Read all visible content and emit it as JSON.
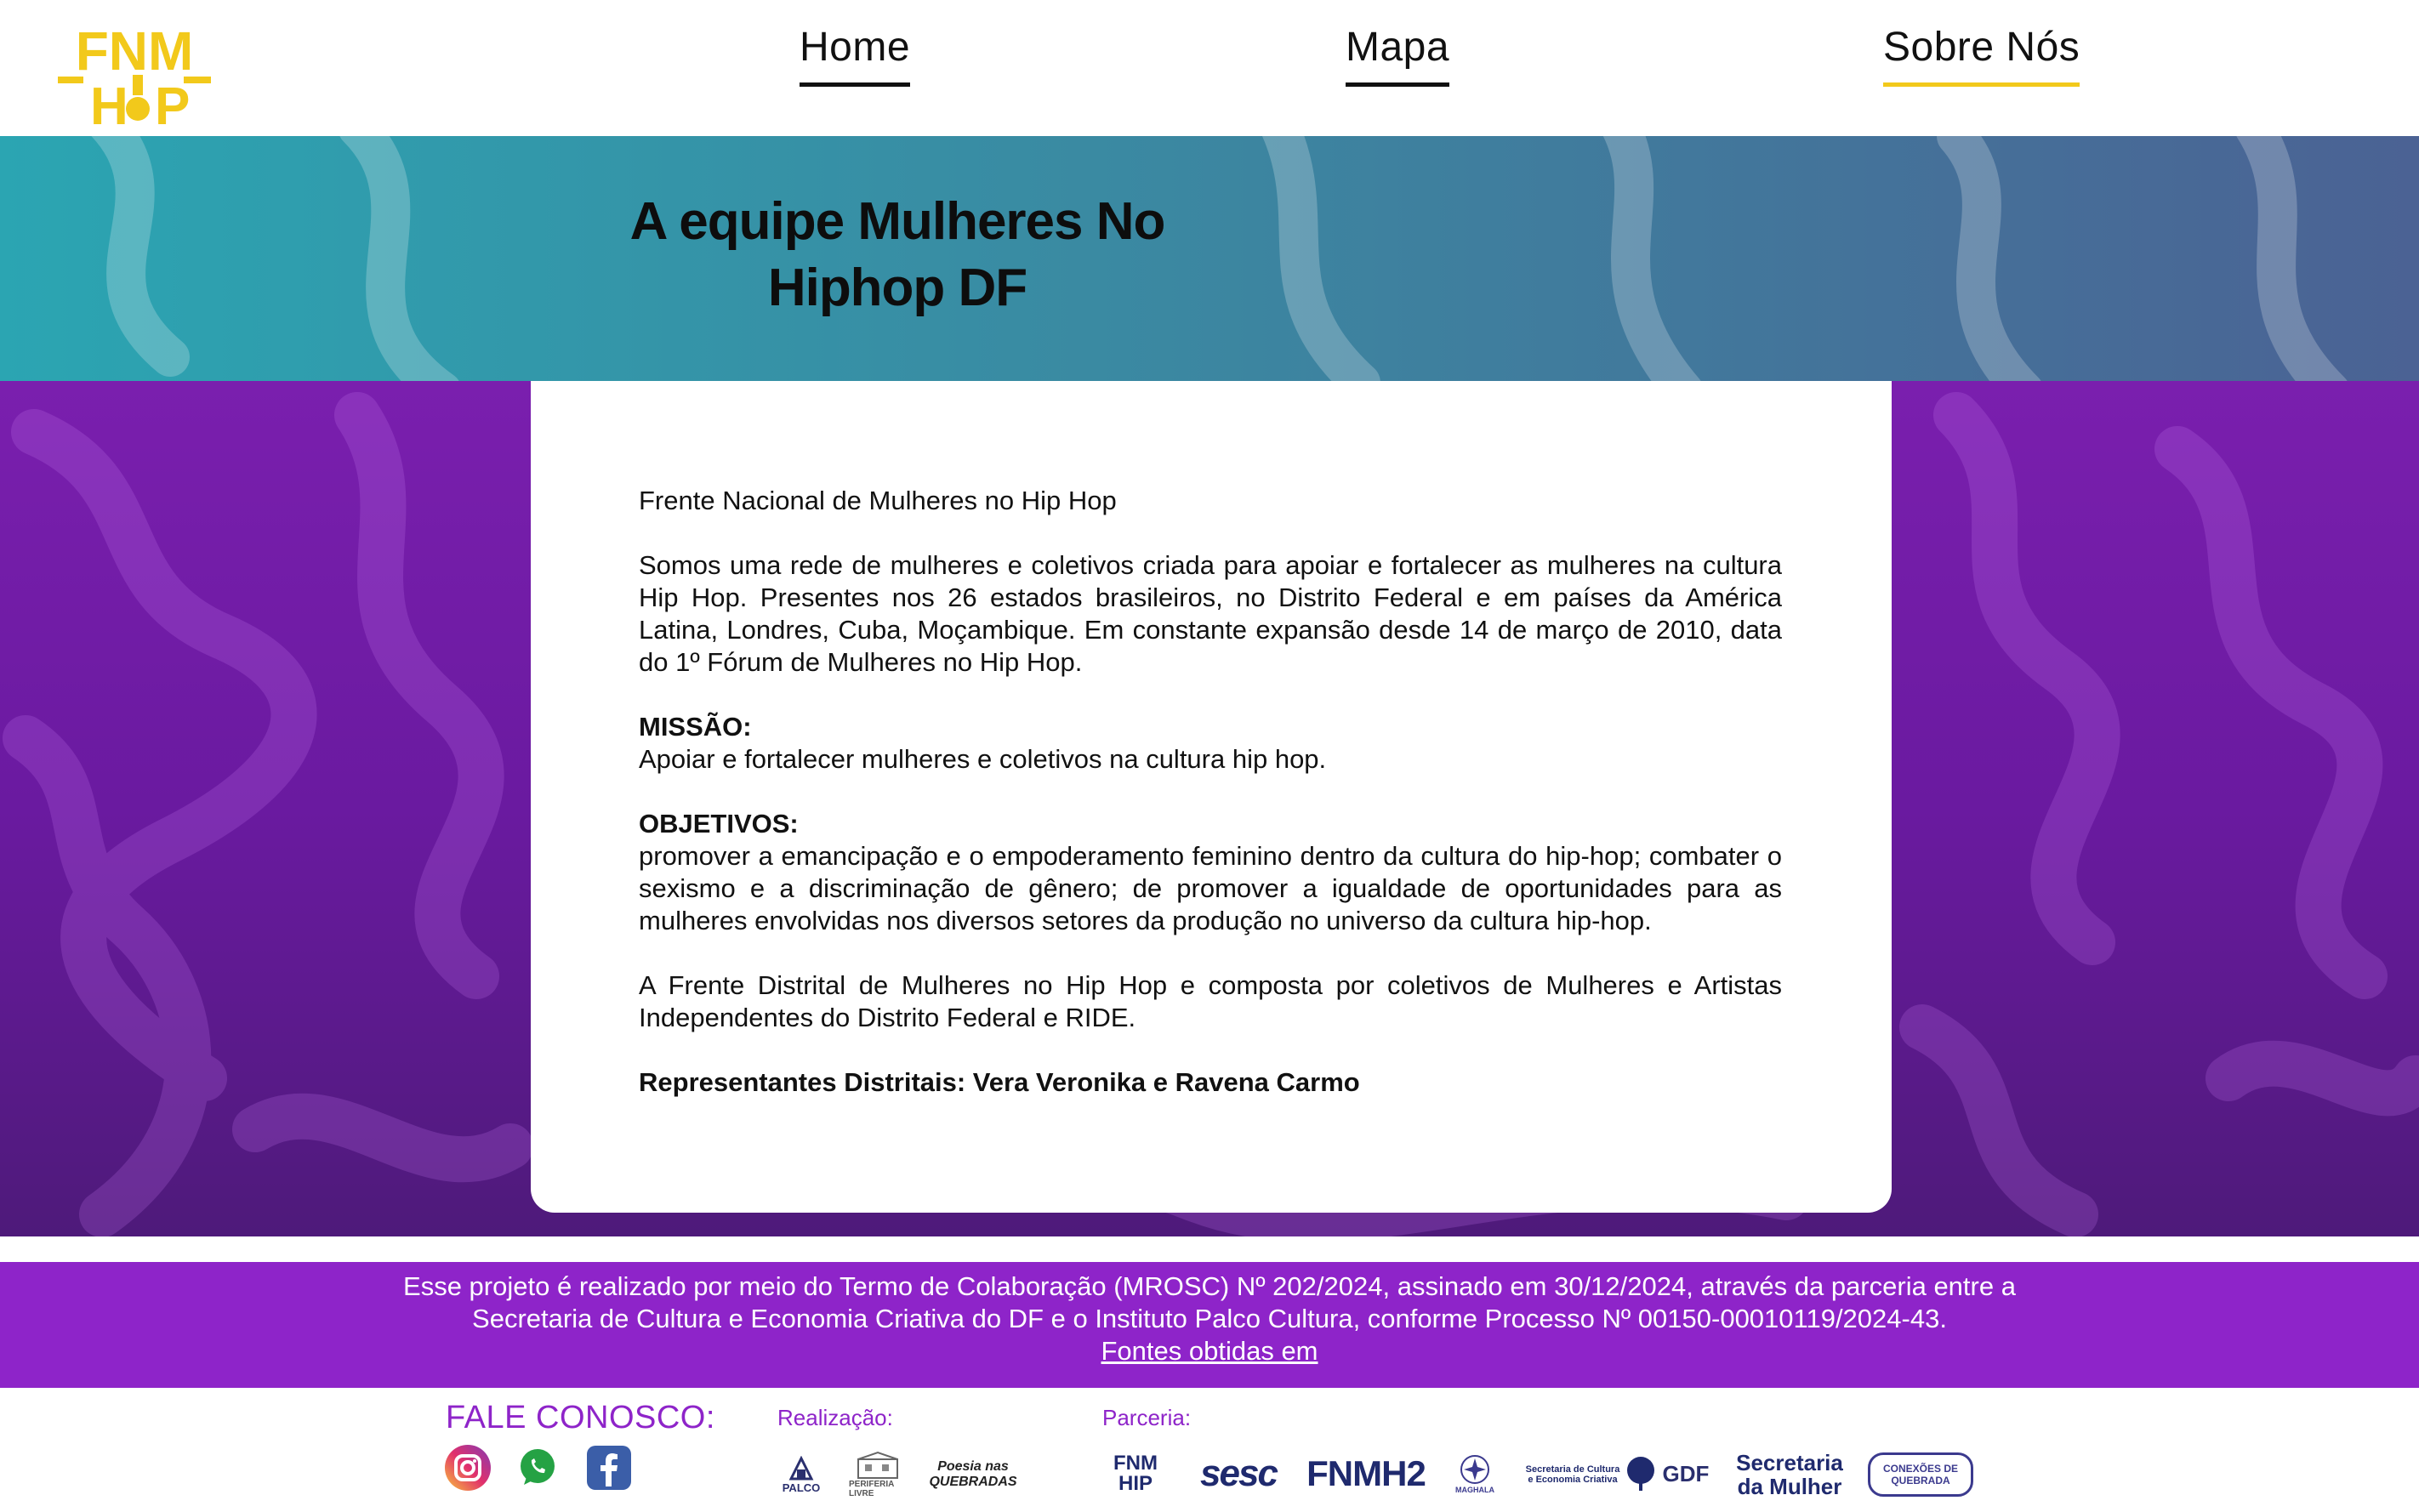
{
  "logo": {
    "line1": "FNM",
    "line2": "HIP"
  },
  "nav": [
    {
      "label": "Home"
    },
    {
      "label": "Mapa"
    },
    {
      "label": "Sobre Nós"
    }
  ],
  "banner": {
    "title_line1": "A equipe Mulheres No",
    "title_line2": "Hiphop DF"
  },
  "content": {
    "intro_title": "Frente Nacional de Mulheres no Hip Hop",
    "intro_text": "Somos uma rede de mulheres e coletivos criada para apoiar e fortalecer as mulheres na cultura Hip Hop. Presentes nos 26 estados brasileiros, no Distrito Federal e em países da América Latina, Londres, Cuba, Moçambique. Em constante expansão desde 14 de março de 2010, data do 1º Fórum de Mulheres no Hip Hop.",
    "missao_heading": "MISSÃO:",
    "missao_text": "Apoiar e fortalecer mulheres e coletivos na cultura hip hop.",
    "objetivos_heading": "OBJETIVOS:",
    "objetivos_text": "promover a emancipação e o empoderamento feminino dentro da cultura do hip-hop; combater o sexismo e a discriminação de gênero; de promover a igualdade de oportunidades para as mulheres envolvidas nos diversos setores da produção no universo da cultura hip-hop.",
    "frente_text": "A Frente Distrital de Mulheres no Hip Hop e composta por coletivos de Mulheres e Artistas Independentes do Distrito Federal e RIDE.",
    "representantes": "Representantes Distritais: Vera Veronika e Ravena Carmo"
  },
  "strip": {
    "line1": "Esse projeto é realizado por meio do Termo de Colaboração (MROSC) Nº 202/2024, assinado em 30/12/2024, através da parceria entre a",
    "line2": "Secretaria de Cultura e Economia Criativa do DF e o Instituto Palco Cultura, conforme Processo Nº 00150-00010119/2024-43.",
    "link": "Fontes obtidas em"
  },
  "footer": {
    "fale_label": "FALE CONOSCO:",
    "realizacao_label": "Realização:",
    "parceria_label": "Parceria:",
    "realizacao_logos": [
      "PALCO",
      "PERIFERIA LIVRE",
      "Poesia nas QUEBRADAS"
    ],
    "parceria_logos": [
      "FNM HIP",
      "sesc",
      "FNMH2",
      "MAGHALA",
      "Secretaria de Cultura e Economia Criativa",
      "GDF",
      "Secretaria",
      "da Mulher",
      "CONEXÕES DE QUEBRADA"
    ]
  },
  "colors": {
    "accent_yellow": "#f2c91b",
    "purple": "#8e24c9",
    "banner_teal": "#2ba5b2"
  }
}
